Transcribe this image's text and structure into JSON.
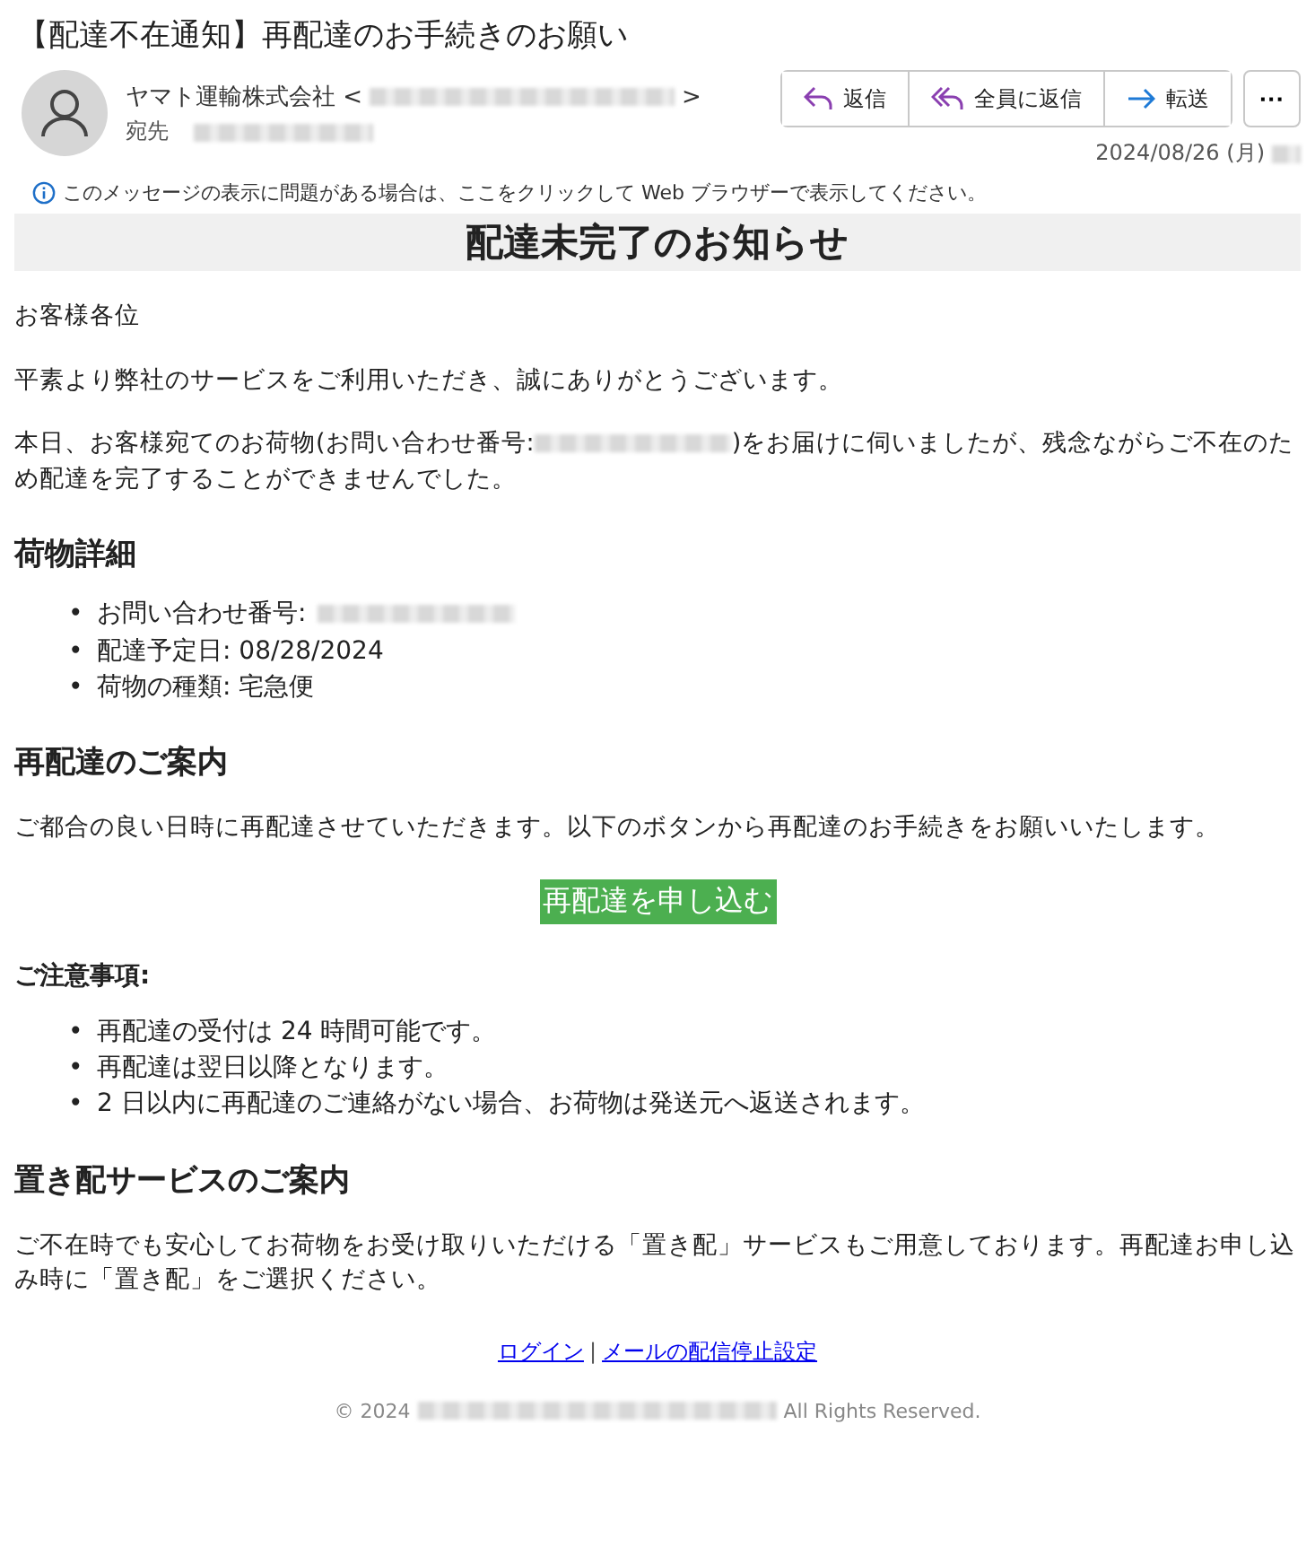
{
  "subject": "【配達不在通知】再配達のお手続きのお願い",
  "sender": {
    "name": "ヤマト運輸株式会社 <",
    "name_end": ">",
    "to_label": "宛先"
  },
  "actions": [
    {
      "kind": "reply",
      "label": "返信"
    },
    {
      "kind": "reply_all",
      "label": "全員に返信"
    },
    {
      "kind": "forward",
      "label": "転送"
    }
  ],
  "more": "···",
  "date": "2024/08/26 (月)",
  "info_bar": "このメッセージの表示に問題がある場合は、ここをクリックして Web ブラウザーで表示してください。",
  "banner": "配達未完了のお知らせ",
  "greeting": "お客様各位",
  "intro": "平素より弊社のサービスをご利用いただき、誠にありがとうございます。",
  "notice": {
    "before": "本日、お客様宛てのお荷物(お問い合わせ番号:",
    "after": ")をお届けに伺いましたが、残念ながらご不在のため配達を完了することができませんでした。"
  },
  "details": {
    "heading": "荷物詳細",
    "items": [
      {
        "text": "お問い合わせ番号:",
        "redacted": true
      },
      {
        "text": "配達予定日: 08/28/2024",
        "redacted": false
      },
      {
        "text": "荷物の種類: 宅急便",
        "redacted": false
      }
    ]
  },
  "redelivery": {
    "heading": "再配達のご案内",
    "text": "ご都合の良い日時に再配達させていただきます。以下のボタンから再配達のお手続きをお願いいたします。",
    "button": "再配達を申し込む"
  },
  "cautions": {
    "heading": "ご注意事項:",
    "items": [
      "再配達の受付は 24 時間可能です。",
      "再配達は翌日以降となります。",
      "2 日以内に再配達のご連絡がない場合、お荷物は発送元へ返送されます。"
    ]
  },
  "dropoff": {
    "heading": "置き配サービスのご案内",
    "text": "ご不在時でも安心してお荷物をお受け取りいただける「置き配」サービスもご用意しております。再配達お申し込み時に「置き配」をご選択ください。"
  },
  "bullet": "•",
  "footer_links": [
    "ログイン",
    "メールの配信停止設定"
  ],
  "footer_separator": "|",
  "copyright": {
    "before": "© 2024",
    "after": "All Rights Reserved."
  }
}
